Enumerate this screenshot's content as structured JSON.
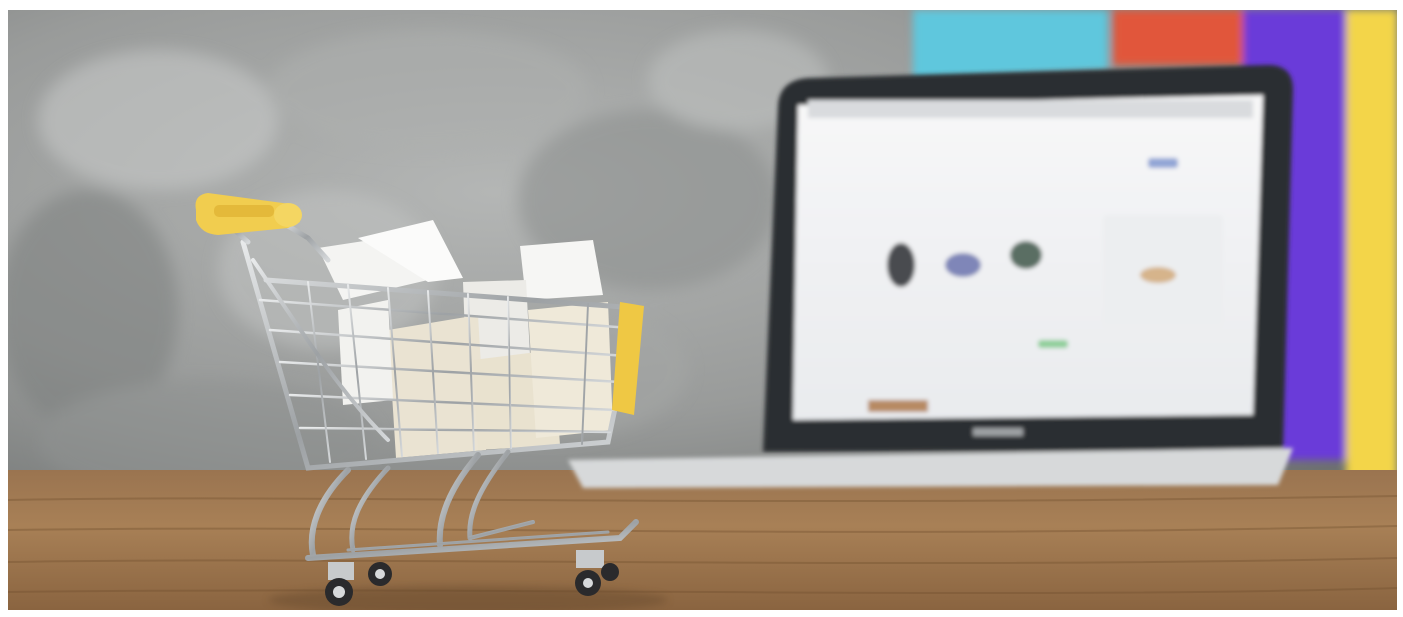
{
  "photo": {
    "subject": "shopping-cart-with-boxes-and-laptop",
    "colors": {
      "wall": "#9a9c9b",
      "wall_dark": "#6f7271",
      "table": "#a87f55",
      "table_dark": "#7a5734",
      "cart_metal": "#b9bcbe",
      "cart_handle": "#f1cd4f",
      "laptop_body": "#c4c6c7",
      "laptop_screen": "#f2f3f5",
      "accent_teal": "#5fc7dd",
      "accent_red": "#e1563a",
      "accent_purple": "#6a3ad9",
      "accent_yellow": "#f3d54a"
    }
  }
}
